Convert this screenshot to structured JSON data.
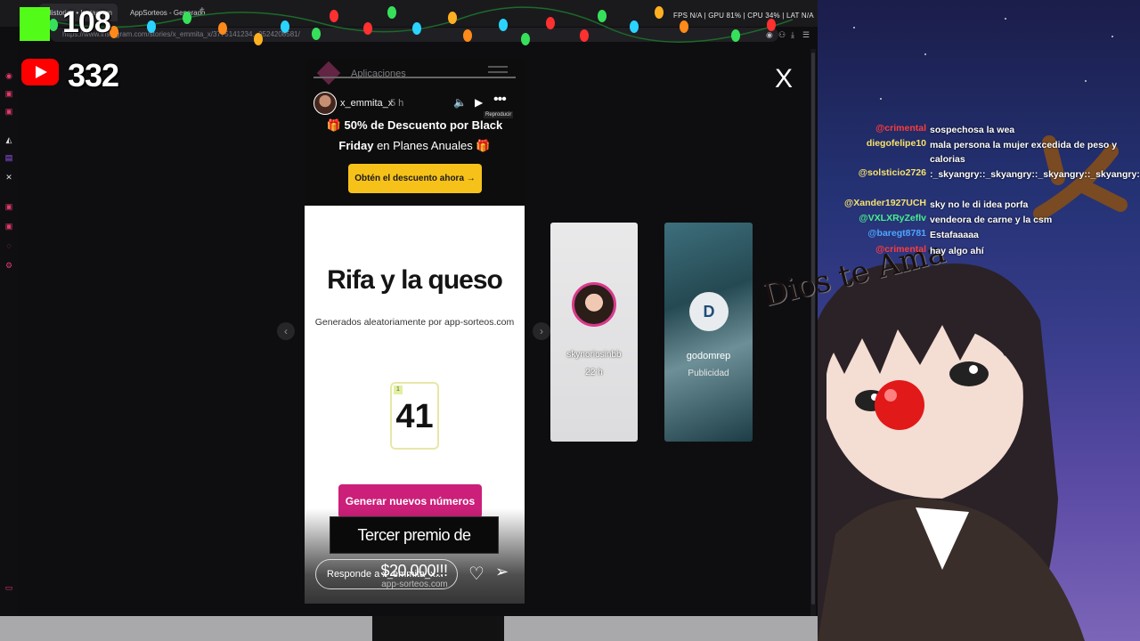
{
  "browser": {
    "tabs": [
      "Historias • Instagram",
      "AppSorteos - Generado"
    ],
    "new_tab": "+",
    "address": "https://www.instagram.com/stories/x_emmita_x/3775141234...0524208581/",
    "stats": "FPS N/A | GPU 81% | CPU 34% | LAT N/A"
  },
  "overlay": {
    "kick_count": "108",
    "youtube_count": "332",
    "close_label": "X"
  },
  "story": {
    "apps_label": "Aplicaciones",
    "username": "x_emmita_x",
    "time": "5 h",
    "tooltip": "Reproducir",
    "promo_line1": "50% de Descuento por Black",
    "promo_line2_bold": "Friday",
    "promo_line2_rest": "en Planes Anuales",
    "promo_button": "Obtén el descuento ahora →",
    "title": "Rifa y la queso",
    "subtitle": "Generados aleatoriamente por app-sorteos.com",
    "number_index": "1",
    "number_value": "41",
    "generate_button": "Generar nuevos números",
    "footer_site": "app-sorteos.com",
    "reply_placeholder": "Responde a x_emmita_x..."
  },
  "banner": "Tercer premio de $20.000!!!",
  "side_cards": [
    {
      "name": "skynoriosinbb",
      "time": "22 h"
    },
    {
      "name": "godomrep",
      "sub": "Publicidad",
      "initials": "D"
    }
  ],
  "chat": [
    {
      "user": "@crimental",
      "text": "sospechosa la wea",
      "color": "#ff3b3b"
    },
    {
      "user": "diegofelipe10",
      "text": "mala persona la mujer excedida de peso y calorias",
      "color": "#f7e26b"
    },
    {
      "user": "@solsticio2726",
      "text": ":_skyangry::_skyangry::_skyangry::_skyangry:",
      "color": "#f7e26b"
    },
    {
      "user": "@Xander1927UCH",
      "text": "sky no le di idea porfa",
      "color": "#f7e26b"
    },
    {
      "user": "@VXLXRyZeflv",
      "text": "vendeora de carne y la csm",
      "color": "#46f08c"
    },
    {
      "user": "@baregt8781",
      "text": "Estafaaaaa",
      "color": "#4ea6ff"
    },
    {
      "user": "@crimental",
      "text": "hay algo ahí",
      "color": "#ff3b3b"
    }
  ],
  "stream_text": "Dios te Ama",
  "colors": {
    "kick": "#53fc18",
    "youtube": "#ff0000",
    "generate": "#cc1f7a",
    "promo": "#f6c21a"
  }
}
